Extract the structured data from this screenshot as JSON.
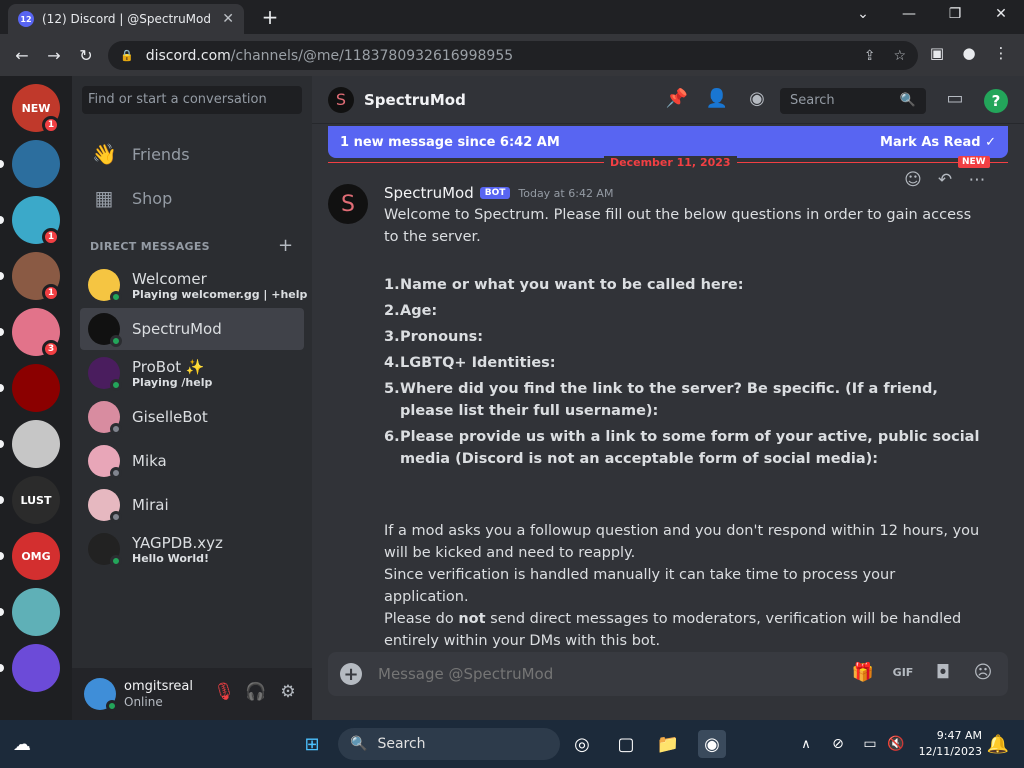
{
  "browser": {
    "tab_title": "(12) Discord | @SpectruMod",
    "tab_badge": "12",
    "url_host": "discord.com",
    "url_path": "/channels/@me/1183780932616998955"
  },
  "servers": [
    {
      "label": "NEW",
      "color": "#c0392b",
      "badge": "1"
    },
    {
      "label": "",
      "color": "#2c6e9e",
      "badge": ""
    },
    {
      "label": "",
      "color": "#3ba9c9",
      "badge": "1"
    },
    {
      "label": "",
      "color": "#8a5a44",
      "badge": "1"
    },
    {
      "label": "",
      "color": "#e2738a",
      "badge": "3"
    },
    {
      "label": "",
      "color": "#8b0000",
      "badge": ""
    },
    {
      "label": "",
      "color": "#c6c6c6",
      "badge": ""
    },
    {
      "label": "LUST",
      "color": "#2b2b2b",
      "badge": ""
    },
    {
      "label": "OMG",
      "color": "#d32f2f",
      "badge": ""
    },
    {
      "label": "",
      "color": "#5fb0b7",
      "badge": ""
    },
    {
      "label": "",
      "color": "#6c4bd8",
      "badge": ""
    }
  ],
  "sidebar": {
    "search_placeholder": "Find or start a conversation",
    "friends": "Friends",
    "shop": "Shop",
    "dm_header": "DIRECT MESSAGES",
    "dms": [
      {
        "name": "Welcomer",
        "status": "Playing welcomer.gg | +help",
        "color": "#f5c542",
        "presence": "#23a55a"
      },
      {
        "name": "SpectruMod",
        "status": "",
        "color": "#111111",
        "presence": "#23a55a"
      },
      {
        "name": "ProBot ✨",
        "status": "Playing /help",
        "color": "#4a1d5e",
        "presence": "#23a55a"
      },
      {
        "name": "GiselleBot",
        "status": "",
        "color": "#d88ca0",
        "presence": "#80848e"
      },
      {
        "name": "Mika",
        "status": "",
        "color": "#e8a6b8",
        "presence": "#80848e"
      },
      {
        "name": "Mirai",
        "status": "",
        "color": "#e6b8c0",
        "presence": "#80848e"
      },
      {
        "name": "YAGPDB.xyz",
        "status": "Hello World!",
        "color": "#222222",
        "presence": "#23a55a"
      }
    ]
  },
  "user": {
    "name": "omgitsreal",
    "status": "Online"
  },
  "channel": {
    "name": "SpectruMod",
    "search_placeholder": "Search",
    "new_messages": "1 new message since 6:42 AM",
    "mark_as_read": "Mark As Read",
    "date_divider": "December 11, 2023",
    "new_tag": "NEW"
  },
  "message": {
    "author": "SpectruMod",
    "bot_tag": "BOT",
    "timestamp": "Today at 6:42 AM",
    "intro": "Welcome to Spectrum. Please fill out the below questions in order to gain access to the server.",
    "questions": [
      {
        "n": "1.",
        "text": "Name or what you want to be called here:"
      },
      {
        "n": "2.",
        "text": "Age:"
      },
      {
        "n": "3.",
        "text": "Pronouns:"
      },
      {
        "n": "4.",
        "text": "LGBTQ+ Identities:"
      },
      {
        "n": "5.",
        "text": "Where did you find the link to the server? Be specific. (If a friend, please list their full username):"
      },
      {
        "n": "6.",
        "text": "Please provide us with a link to some form of your active, public social media (Discord is not an acceptable form of social media):"
      }
    ],
    "outro1": "If a mod asks you a followup question and you don't respond within 12 hours, you will be kicked and need to reapply.",
    "outro2": "Since verification is handled manually it can take time to process your application.",
    "outro3_a": "Please do ",
    "outro3_b": "not",
    "outro3_c": " send direct messages to moderators, verification will be handled entirely within your DMs with this bot."
  },
  "composer": {
    "placeholder": "Message @SpectruMod"
  },
  "taskbar": {
    "search": "Search",
    "time": "9:47 AM",
    "date": "12/11/2023"
  }
}
